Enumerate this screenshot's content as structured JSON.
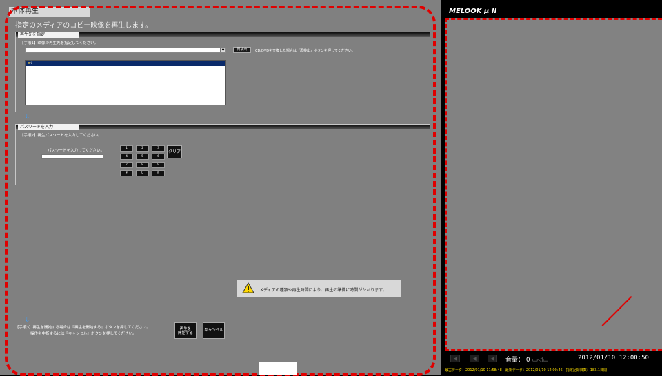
{
  "main": {
    "title": "本体再生",
    "subtitle": "指定のメディアのコピー映像を再生します。",
    "source_panel": {
      "tab": "再生先を指定",
      "step1": "【手順1】映像の再生先を指定してください。",
      "combo_value": "",
      "redetect_label": "再検出",
      "redetect_hint": "CD/DVDを交換した場合は『再検出』ボタンを押してください。",
      "list_items": [
        ":"
      ]
    },
    "password_panel": {
      "tab": "パスワードを入力",
      "step2": "【手順2】再生パスワードを入力してください。",
      "input_label": "パスワードを入力してください。",
      "keys": [
        "1",
        "2",
        "3",
        "4",
        "5",
        "6",
        "7",
        "8",
        "9",
        "＊",
        "0",
        "＃"
      ],
      "clear_label": "クリア"
    },
    "notice": "メディアの種類や再生時間により、再生の準備に時間がかかります。",
    "step3_line1": "【手順3】再生を開始する場合は『再生を開始する』ボタンを押してください。",
    "step3_line2": "操作を中断するには『キャンセル』ボタンを押してください。",
    "start_label_1": "再生を",
    "start_label_2": "開始する",
    "cancel_label": "キャンセル"
  },
  "right": {
    "logo": "MELOOK μ II",
    "volume_label": "音量：",
    "volume_value": "0",
    "datetime": "2012/01/10 12:00:50",
    "status": "最古データ：2012/01/10 11:58:48　最新データ：2012/01/10 12:00:46　指定記録日数：183.1日間"
  },
  "colors": {
    "panel_bg": "#808080",
    "dash": "#e00000",
    "status_text": "#ffe000",
    "arrow": "#3aa0ff"
  }
}
